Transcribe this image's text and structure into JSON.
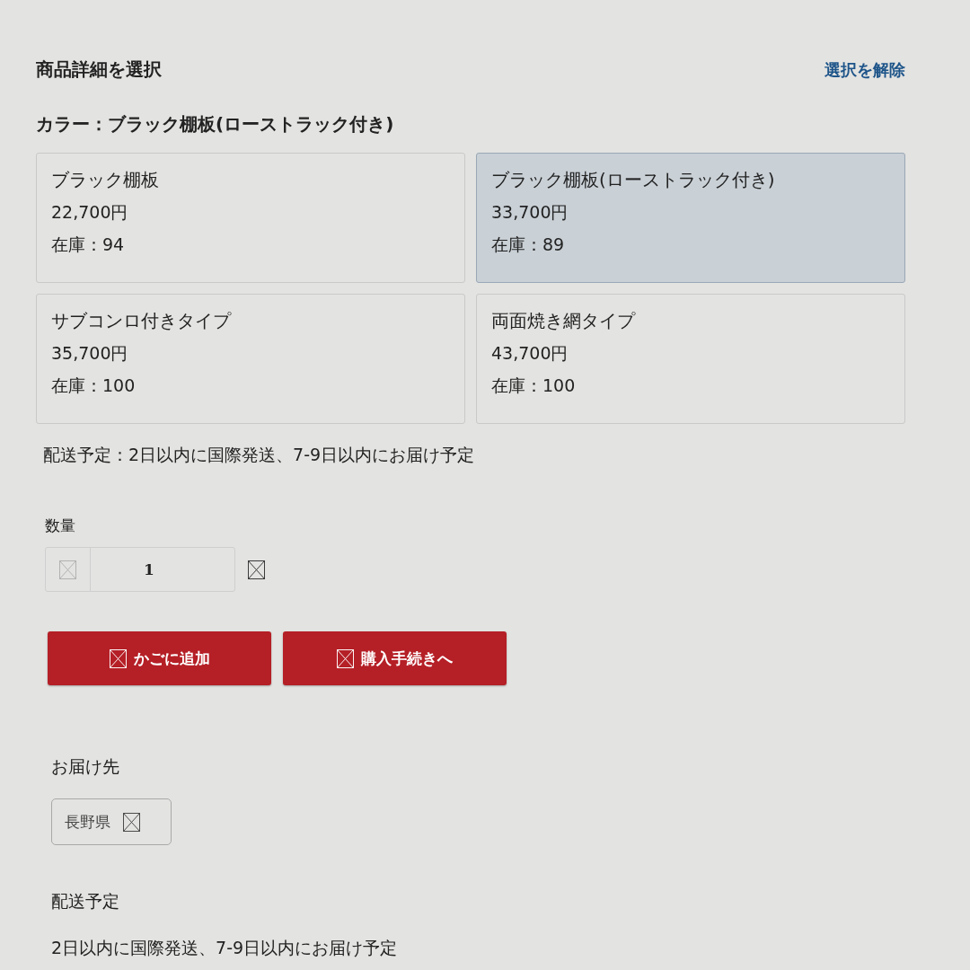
{
  "header": {
    "title": "商品詳細を選択",
    "clear_link": "選択を解除"
  },
  "selection": {
    "label": "カラー：ブラック棚板(ローストラック付き)"
  },
  "options": [
    {
      "name": "ブラック棚板",
      "price": "22,700円",
      "stock": "在庫：94",
      "selected": false
    },
    {
      "name": "ブラック棚板(ローストラック付き)",
      "price": "33,700円",
      "stock": "在庫：89",
      "selected": true
    },
    {
      "name": "サブコンロ付きタイプ",
      "price": "35,700円",
      "stock": "在庫：100",
      "selected": false
    },
    {
      "name": "両面焼き網タイプ",
      "price": "43,700円",
      "stock": "在庫：100",
      "selected": false
    }
  ],
  "shipping_note": "配送予定：2日以内に国際発送、7-9日以内にお届け予定",
  "quantity": {
    "label": "数量",
    "value": "1",
    "decrement_disabled": true,
    "increment_disabled": false
  },
  "buttons": [
    {
      "label": "かごに追加"
    },
    {
      "label": "購入手続きへ"
    }
  ],
  "destination": {
    "label": "お届け先",
    "value": "長野県"
  },
  "delivery": {
    "label": "配送予定",
    "text": "2日以内に国際発送、7-9日以内にお届け予定"
  }
}
